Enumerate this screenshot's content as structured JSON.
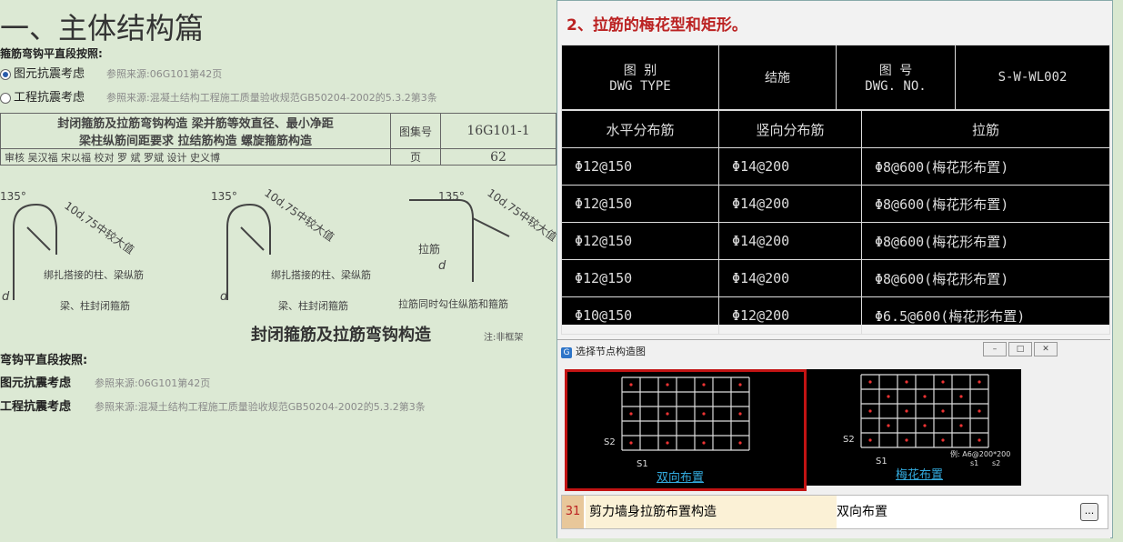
{
  "left": {
    "title": "一、主体结构篇",
    "top_setting": {
      "label": "箍筋弯钩平直段按照:",
      "options": [
        {
          "label": "图元抗震考虑",
          "source": "参照来源:06G101第42页",
          "selected": true
        },
        {
          "label": "工程抗震考虑",
          "source": "参照来源:混凝土结构工程施工质量验收规范GB50204-2002的5.3.2第3条",
          "selected": false
        }
      ]
    },
    "title_block": {
      "line1": "封闭箍筋及拉筋弯钩构造  梁并筋等效直径、最小净距",
      "line2": "梁柱纵筋间距要求  拉结筋构造  螺旋箍筋构造",
      "atlas_label": "图集号",
      "atlas_no": "16G101-1",
      "page_label": "页",
      "page_no": "62",
      "signatures": "审核 吴汉福  宋以福  校对 罗 斌  罗斌  设计 史义博"
    },
    "figure": {
      "angle": "135°",
      "length_note": "10d,75中较大值",
      "label_tie": "拉筋",
      "d": "d",
      "note1": "绑扎搭接的柱、梁纵筋",
      "note2": "梁、柱封闭箍筋",
      "note3": "拉筋同时勾住纵筋和箍筋",
      "caption": "封闭箍筋及拉筋弯钩构造",
      "footnote": "注:非框架"
    },
    "bottom_setting": {
      "label": "弯钩平直段按照:",
      "options": [
        {
          "label": "图元抗震考虑",
          "source": "参照来源:06G101第42页"
        },
        {
          "label": "工程抗震考虑",
          "source": "参照来源:混凝土结构工程施工质量验收规范GB50204-2002的5.3.2第3条"
        }
      ]
    }
  },
  "right": {
    "heading": "2、拉筋的梅花型和矩形。",
    "cad": {
      "dwg_type_cn": "图 别",
      "dwg_type_en": "DWG TYPE",
      "structure": "结施",
      "dwg_no_cn": "图 号",
      "dwg_no_en": "DWG. NO.",
      "dwg_no": "S-W-WL002",
      "columns": [
        "水平分布筋",
        "竖向分布筋",
        "拉筋"
      ],
      "rows": [
        [
          "Φ12@150",
          "Φ14@200",
          "Φ8@600(梅花形布置)"
        ],
        [
          "Φ12@150",
          "Φ14@200",
          "Φ8@600(梅花形布置)"
        ],
        [
          "Φ12@150",
          "Φ14@200",
          "Φ8@600(梅花形布置)"
        ],
        [
          "Φ12@150",
          "Φ14@200",
          "Φ8@600(梅花形布置)"
        ],
        [
          "Φ10@150",
          "Φ12@200",
          "Φ6.5@600(梅花形布置)"
        ]
      ]
    },
    "dialog": {
      "title": "选择节点构造图",
      "options": [
        {
          "label": "双向布置",
          "s1": "S1",
          "s2": "S2"
        },
        {
          "label": "梅花布置",
          "s1": "S1",
          "s2": "S2",
          "example": "例: A6@200*200",
          "ex_s1": "s1",
          "ex_s2": "s2"
        }
      ]
    },
    "property_row": {
      "index": "31",
      "name": "剪力墙身拉筋布置构造",
      "value": "双向布置",
      "more": "..."
    }
  }
}
